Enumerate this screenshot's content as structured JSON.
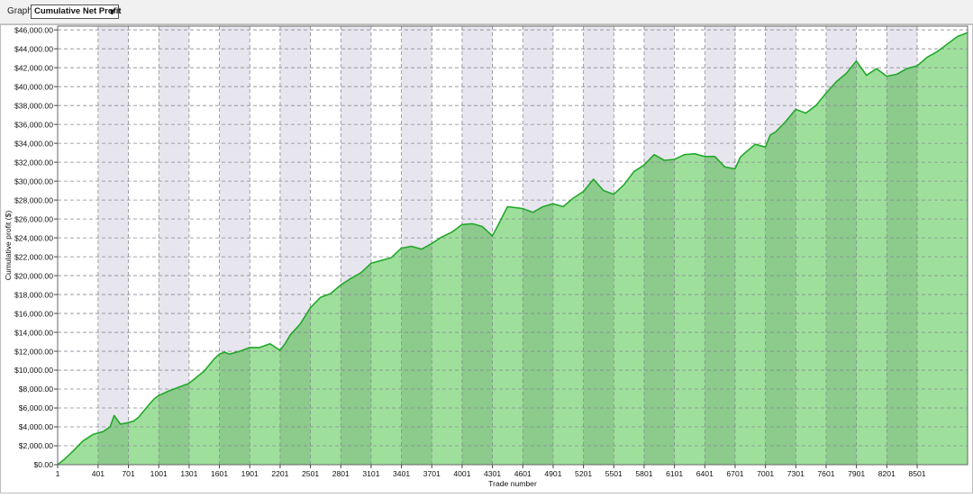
{
  "toolbar": {
    "graph_label": "Graph",
    "graph_select": "Cumulative Net Profit"
  },
  "chart_data": {
    "type": "area",
    "title": "",
    "xlabel": "Trade number",
    "ylabel": "Cumulative profit ($)",
    "xlim": [
      1,
      9000
    ],
    "ylim": [
      0,
      46400
    ],
    "x_ticks": [
      1,
      401,
      701,
      1001,
      1301,
      1601,
      1901,
      2201,
      2501,
      2801,
      3101,
      3401,
      3701,
      4001,
      4301,
      4601,
      4901,
      5201,
      5501,
      5801,
      6101,
      6401,
      6701,
      7001,
      7301,
      7601,
      7901,
      8201,
      8501
    ],
    "y_ticks": [
      "$0.00",
      "$2,000.00",
      "$4,000.00",
      "$6,000.00",
      "$8,000.00",
      "$10,000.00",
      "$12,000.00",
      "$14,000.00",
      "$16,000.00",
      "$18,000.00",
      "$20,000.00",
      "$22,000.00",
      "$24,000.00",
      "$26,000.00",
      "$28,000.00",
      "$30,000.00",
      "$32,000.00",
      "$34,000.00",
      "$36,000.00",
      "$38,000.00",
      "$40,000.00",
      "$42,000.00",
      "$44,000.00",
      "$46,000.00"
    ],
    "y_values": [
      0,
      2000,
      4000,
      6000,
      8000,
      10000,
      12000,
      14000,
      16000,
      18000,
      20000,
      22000,
      24000,
      26000,
      28000,
      30000,
      32000,
      34000,
      36000,
      38000,
      40000,
      42000,
      44000,
      46000
    ],
    "grid": true,
    "colors": {
      "line": "#22a82a",
      "fill_light": "#9ee09b",
      "fill_dark": "#8ccb8c",
      "band": "#e7e6ee"
    },
    "series": [
      {
        "x": [
          1,
          60,
          150,
          250,
          350,
          450,
          520,
          560,
          620,
          680,
          750,
          800,
          900,
          960,
          1000,
          1100,
          1200,
          1300,
          1380,
          1450,
          1550,
          1600,
          1650,
          1700,
          1800,
          1900,
          2000,
          2100,
          2200,
          2250,
          2300,
          2400,
          2500,
          2600,
          2700,
          2800,
          2900,
          3000,
          3100,
          3200,
          3300,
          3400,
          3500,
          3600,
          3700,
          3800,
          3900,
          4000,
          4100,
          4200,
          4300,
          4350,
          4450,
          4600,
          4700,
          4800,
          4900,
          5000,
          5100,
          5200,
          5300,
          5400,
          5500,
          5600,
          5700,
          5800,
          5900,
          6000,
          6100,
          6200,
          6300,
          6400,
          6500,
          6600,
          6700,
          6750,
          6800,
          6900,
          7000,
          7050,
          7100,
          7200,
          7300,
          7400,
          7500,
          7600,
          7700,
          7800,
          7900,
          8000,
          8100,
          8200,
          8300,
          8400,
          8500,
          8600,
          8700,
          8800,
          8900,
          9000
        ],
        "y": [
          0,
          500,
          1400,
          2500,
          3200,
          3500,
          4000,
          5200,
          4300,
          4400,
          4600,
          5000,
          6300,
          7000,
          7300,
          7800,
          8200,
          8600,
          9300,
          9900,
          11200,
          11700,
          11900,
          11700,
          12000,
          12400,
          12400,
          12800,
          12100,
          12800,
          13700,
          14900,
          16600,
          17700,
          18100,
          19000,
          19700,
          20300,
          21300,
          21600,
          21900,
          22900,
          23100,
          22800,
          23400,
          24100,
          24600,
          25400,
          25500,
          25200,
          24200,
          25200,
          27300,
          27100,
          26700,
          27300,
          27600,
          27300,
          28200,
          28900,
          30200,
          29000,
          28600,
          29600,
          31000,
          31700,
          32800,
          32200,
          32300,
          32800,
          32900,
          32600,
          32600,
          31500,
          31300,
          32500,
          33000,
          33900,
          33600,
          34900,
          35200,
          36300,
          37600,
          37200,
          38000,
          39300,
          40500,
          41400,
          42700,
          41200,
          41900,
          41100,
          41300,
          41900,
          42200,
          43100,
          43700,
          44500,
          45300,
          45700
        ]
      }
    ]
  }
}
